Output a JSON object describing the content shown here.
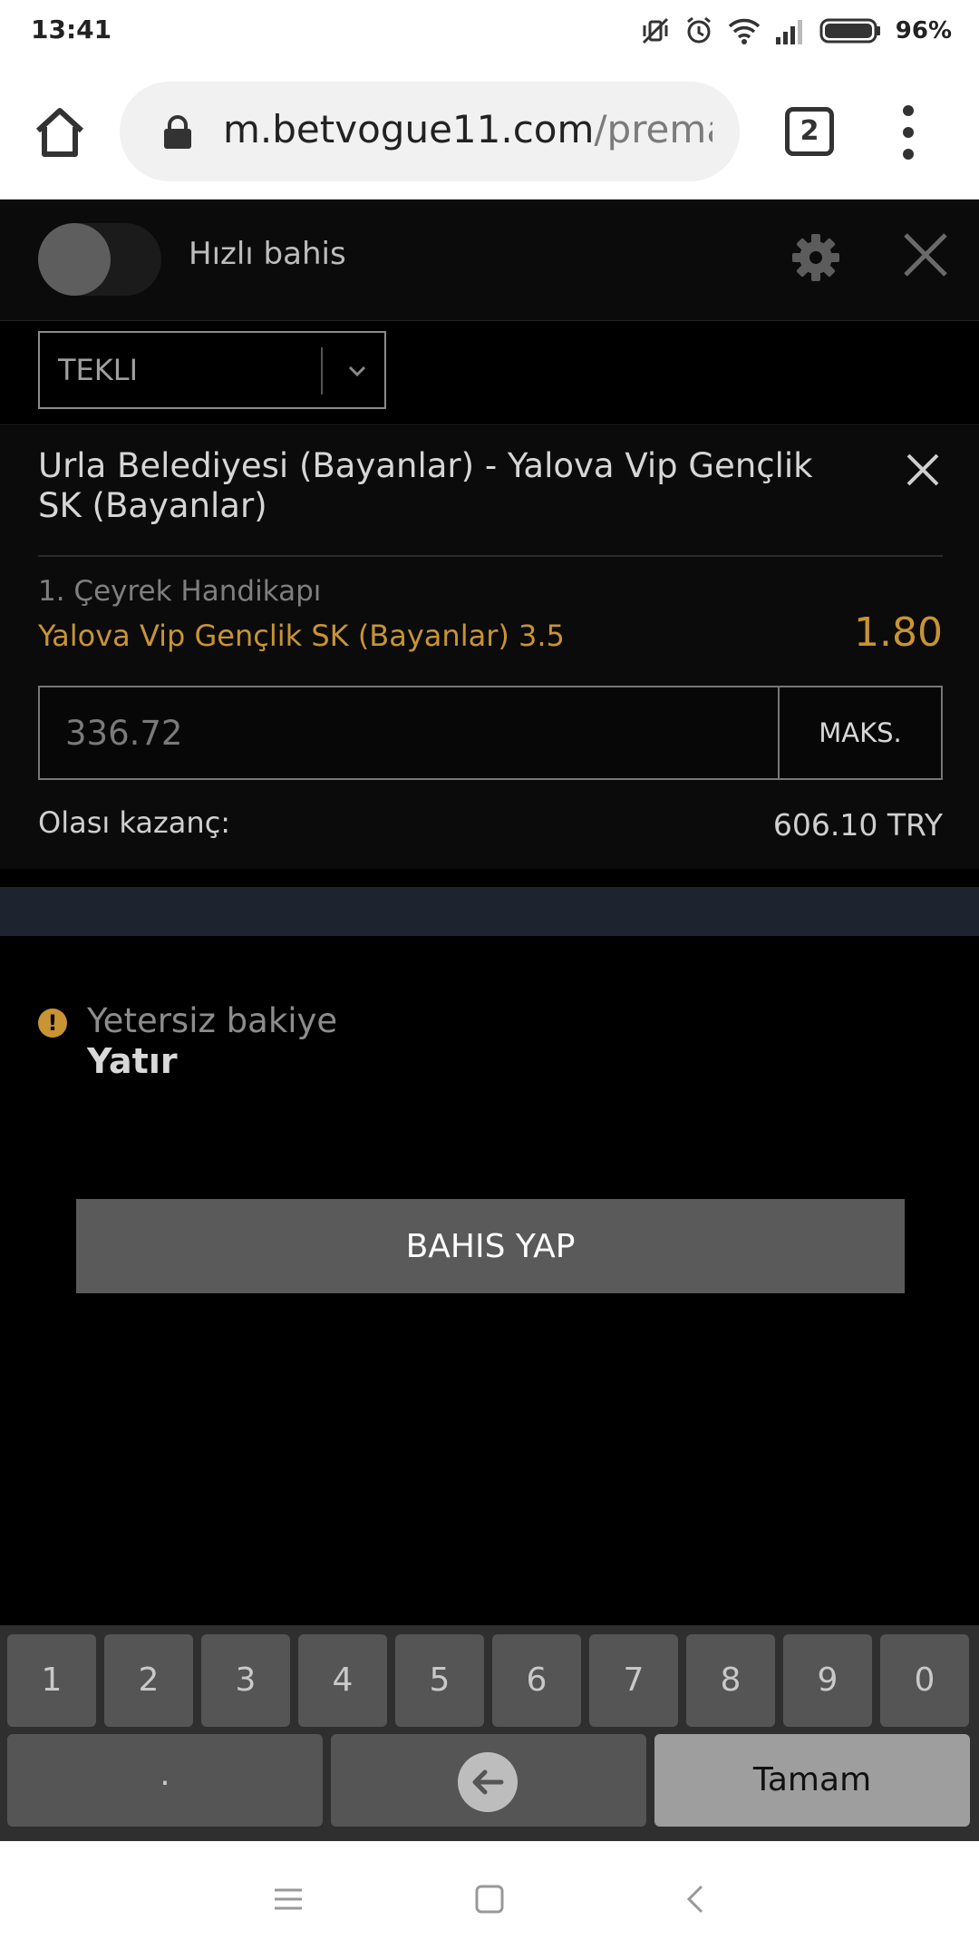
{
  "status_bar": {
    "time": "13:41",
    "battery_percent": "96%",
    "icons": [
      "vibrate-off-icon",
      "alarm-icon",
      "wifi-icon",
      "signal-icon",
      "battery-icon"
    ]
  },
  "browser": {
    "url_host": "m.betvogue11.com",
    "url_path": "/premat",
    "tab_count": "2"
  },
  "bet_header": {
    "quick_bet_label": "Hızlı bahis"
  },
  "bet_type": {
    "selected": "TEKLI"
  },
  "slip": {
    "match": "Urla Belediyesi (Bayanlar) - Yalova Vip Gençlik SK (Bayanlar)",
    "market": "1. Çeyrek Handikapı",
    "selection": "Yalova Vip Gençlik SK (Bayanlar) 3.5",
    "odds": "1.80",
    "stake_value": "336.72",
    "max_label": "MAKS.",
    "payout_label": "Olası kazanç:",
    "payout_value": "606.10 TRY"
  },
  "warning": {
    "text": "Yetersiz bakiye",
    "deposit_label": "Yatır"
  },
  "place_bet_label": "BAHIS YAP",
  "keyboard": {
    "keys": [
      "1",
      "2",
      "3",
      "4",
      "5",
      "6",
      "7",
      "8",
      "9",
      "0"
    ],
    "decimal": ".",
    "done": "Tamam"
  },
  "colors": {
    "accent": "#c89434",
    "panel": "#0b0b0b",
    "band": "#1e2330",
    "button": "#5a5a5a"
  }
}
